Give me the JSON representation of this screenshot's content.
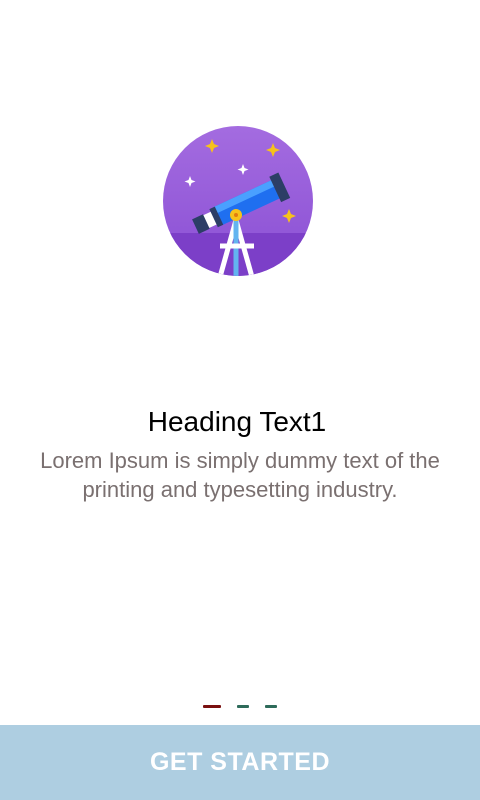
{
  "onboarding": {
    "illustration_icon": "telescope-icon",
    "heading": "Heading Text1",
    "body": "Lorem Ipsum is simply dummy text of the printing and typesetting industry.",
    "pager": {
      "total_pages": 3,
      "current_page": 1,
      "active_color": "#7a1010",
      "inactive_color": "#2e6b5a"
    },
    "cta": {
      "label": "GET STARTED",
      "background_color": "#aecee1",
      "text_color": "#ffffff"
    }
  }
}
